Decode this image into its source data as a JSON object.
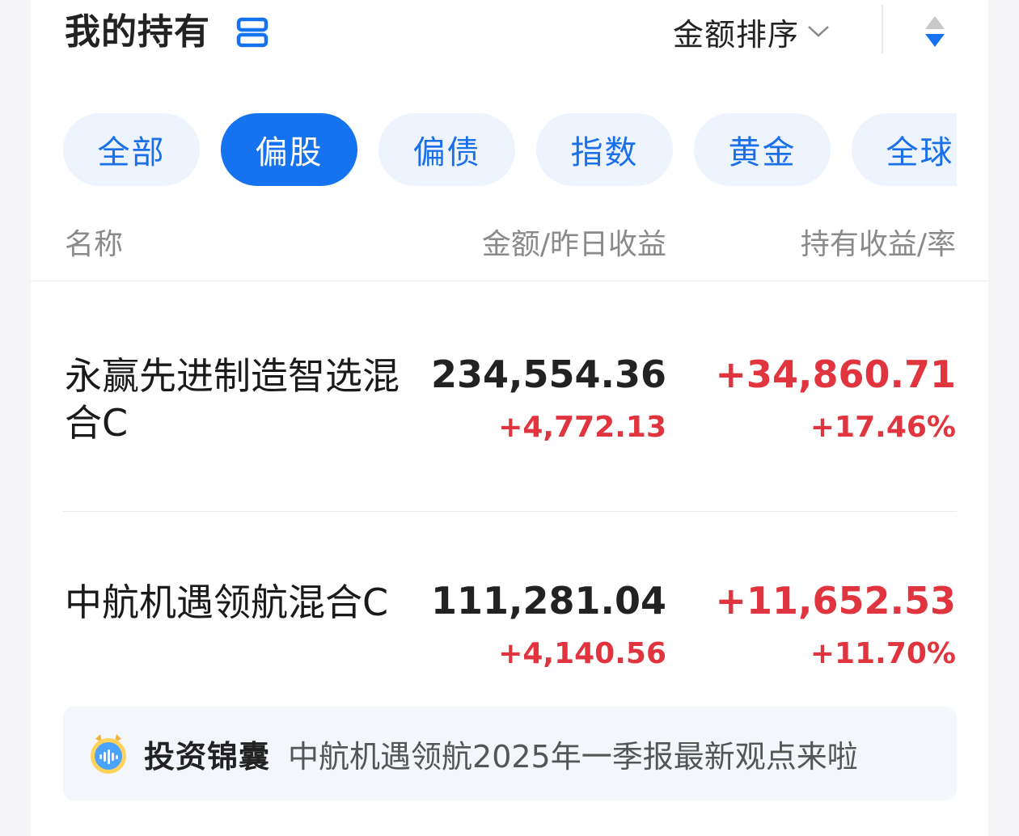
{
  "header": {
    "title": "我的持有",
    "sort_label": "金额排序"
  },
  "tabs": [
    {
      "label": "全部",
      "active": false
    },
    {
      "label": "偏股",
      "active": true
    },
    {
      "label": "偏债",
      "active": false
    },
    {
      "label": "指数",
      "active": false
    },
    {
      "label": "黄金",
      "active": false
    },
    {
      "label": "全球",
      "active": false
    }
  ],
  "columns": {
    "name": "名称",
    "amount": "金额/昨日收益",
    "holding": "持有收益/率"
  },
  "funds": [
    {
      "name_line1": "永赢先进制造智选混",
      "name_line2": "合C",
      "amount": "234,554.36",
      "day_gain": "+4,772.13",
      "hold_gain": "+34,860.71",
      "hold_rate": "+17.46%"
    },
    {
      "name_line1": "中航机遇领航混合C",
      "name_line2": "",
      "amount": "111,281.04",
      "day_gain": "+4,140.56",
      "hold_gain": "+11,652.53",
      "hold_rate": "+11.70%"
    }
  ],
  "banner": {
    "tag": "投资锦囊",
    "text": "中航机遇领航2025年一季报最新观点来啦"
  },
  "colors": {
    "accent": "#1673f0",
    "gain_red": "#e0353e",
    "tab_bg": "#eef4fd"
  }
}
